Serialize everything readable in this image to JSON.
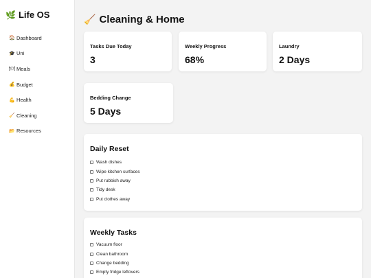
{
  "app": {
    "brand_icon": "🌿",
    "brand_title": "Life OS"
  },
  "sidebar": {
    "items": [
      {
        "icon": "🏠",
        "icon_name": "house-icon",
        "label": "Dashboard"
      },
      {
        "icon": "🎓",
        "icon_name": "graduation-cap-icon",
        "label": "Uni"
      },
      {
        "icon": "🍽",
        "icon_name": "plate-icon",
        "label": "Meals"
      },
      {
        "icon": "💰",
        "icon_name": "money-bag-icon",
        "label": "Budget"
      },
      {
        "icon": "💪",
        "icon_name": "flexed-arm-icon",
        "label": "Health"
      },
      {
        "icon": "🧹",
        "icon_name": "broom-icon",
        "label": "Cleaning"
      },
      {
        "icon": "📂",
        "icon_name": "folder-icon",
        "label": "Resources"
      }
    ]
  },
  "header": {
    "icon": "🧹",
    "title": "Cleaning & Home"
  },
  "stats": [
    {
      "label": "Tasks Due Today",
      "value": "3"
    },
    {
      "label": "Weekly Progress",
      "value": "68%"
    },
    {
      "label": "Laundry",
      "value": "2 Days"
    },
    {
      "label": "Bedding Change",
      "value": "5 Days"
    }
  ],
  "daily": {
    "title": "Daily Reset",
    "items": [
      "Wash dishes",
      "Wipe kitchen surfaces",
      "Put rubbish away",
      "Tidy desk",
      "Put clothes away"
    ]
  },
  "weekly": {
    "title": "Weekly Tasks",
    "items": [
      "Vacuum floor",
      "Clean bathroom",
      "Change bedding",
      "Empty fridge leftovers"
    ]
  },
  "colors": {
    "background": "#f3f3f3",
    "card": "#ffffff",
    "text": "#111111"
  }
}
